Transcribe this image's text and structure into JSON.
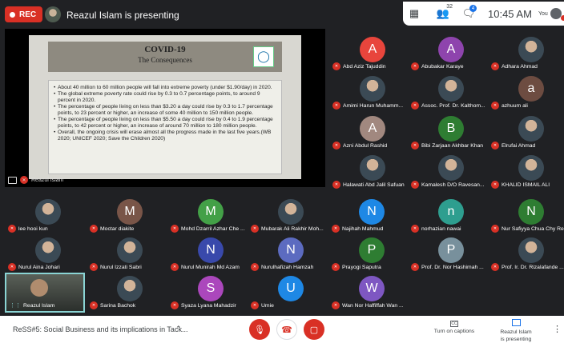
{
  "top": {
    "rec_label": "REC",
    "presenter_text": "Reazul Islam is presenting",
    "participants_count": "32",
    "chat_count": "4",
    "time": "10:45 AM",
    "you_label": "You"
  },
  "slide": {
    "title": "COVID-19",
    "subtitle": "The Consequences",
    "bullets": [
      "About 40 million to 60 million people will fall into extreme poverty (under $1.90/day) in 2020.",
      "The global extreme poverty rate could rise by 0.3 to 0.7 percentage points, to around 9 percent in 2020.",
      "The percentage of people living on less than $3.20 a day could rise by 0.3 to 1.7 percentage points, to 23 percent or higher, an increase of some 40 million to 150 million people.",
      "The percentage of people living on less than $5.50 a day could rise by 0.4 to 1.9 percentage points, to 42 percent or higher, an increase of around 70 million to 180 million people.",
      "Overall, the ongoing crisis will erase almost all the progress made in the last five years.(WB 2020; UNICEF 2020; Save the Children 2020)"
    ],
    "presenter_tag": "Reazul Islam"
  },
  "participants": [
    {
      "name": "Abd Aziz Tajuddin",
      "initial": "A",
      "color": "#e8453c"
    },
    {
      "name": "Abubakar Karaye",
      "initial": "A",
      "color": "#8e44ad"
    },
    {
      "name": "Adhara Ahmad",
      "initial": "",
      "color": "#3b3b3b"
    },
    {
      "name": "Amimi Harun Muhamm...",
      "initial": "",
      "color": "#5e5448"
    },
    {
      "name": "Assoc. Prof. Dr. Kalthom...",
      "initial": "",
      "color": "#7a6a55"
    },
    {
      "name": "azhuum ali",
      "initial": "a",
      "color": "#6d4c41"
    },
    {
      "name": "Azni Abdul Rashid",
      "initial": "A",
      "color": "#a1887f"
    },
    {
      "name": "Bibi Zarjaan Akhbar Khan",
      "initial": "B",
      "color": "#2e7d32"
    },
    {
      "name": "Elrufai Ahmad",
      "initial": "",
      "color": "#4a4a4a"
    },
    {
      "name": "Halawati Abd Jalil Safuan",
      "initial": "",
      "color": "#1f4e79"
    },
    {
      "name": "Kamalesh D/O Ravesan...",
      "initial": "",
      "color": "#7b5c4a"
    },
    {
      "name": "KHALID ISMAIL ALI",
      "initial": "",
      "color": "#3c3c3c"
    },
    {
      "name": "lee hooi kun",
      "initial": "",
      "color": "#6b7a5a"
    },
    {
      "name": "Moctar diakite",
      "initial": "M",
      "color": "#795548"
    },
    {
      "name": "Mohd Dzarril Azhar Che ...",
      "initial": "M",
      "color": "#43a047"
    },
    {
      "name": "Mubarak Ali Rakhir Moh...",
      "initial": "",
      "color": "#556070"
    },
    {
      "name": "Najihah Mahmud",
      "initial": "N",
      "color": "#1e88e5"
    },
    {
      "name": "norhazian nawai",
      "initial": "n",
      "color": "#2e9e8f"
    },
    {
      "name": "Nur Safiyya Chua Chy Re",
      "initial": "N",
      "color": "#2e7d32"
    },
    {
      "name": "Nurul Aina Johari",
      "initial": "",
      "color": "#5d6d7e"
    },
    {
      "name": "Nurul Izzati Sabri",
      "initial": "",
      "color": "#a0495a"
    },
    {
      "name": "Nurul Munirah Md Azam",
      "initial": "N",
      "color": "#3949ab"
    },
    {
      "name": "Nurulhafizah Hamzah",
      "initial": "N",
      "color": "#5c6bc0"
    },
    {
      "name": "Prayogi Saputra",
      "initial": "P",
      "color": "#2e7d32"
    },
    {
      "name": "Prof. Dr. Nor Hashimah ...",
      "initial": "P",
      "color": "#78909c"
    },
    {
      "name": "Prof. Ir. Dr. Rizalafande ...",
      "initial": "",
      "color": "#e0e0e0"
    },
    {
      "name": "Sarina Bachok",
      "initial": "",
      "color": "#4e5b66"
    },
    {
      "name": "Syaza Lyana Mahadzir",
      "initial": "S",
      "color": "#ab47bc"
    },
    {
      "name": "Umie",
      "initial": "U",
      "color": "#1e88e5"
    },
    {
      "name": "Wan Nor Haffiffah Wan ...",
      "initial": "W",
      "color": "#7e57c2"
    }
  ],
  "self_tile": {
    "name": "Reazul Islam"
  },
  "bottom": {
    "meeting_title": "ReSS#5: Social Business and its implications in Tack...",
    "captions_label": "Turn on captions",
    "presenting_line1": "Reazul Islam",
    "presenting_line2": "is presenting"
  }
}
